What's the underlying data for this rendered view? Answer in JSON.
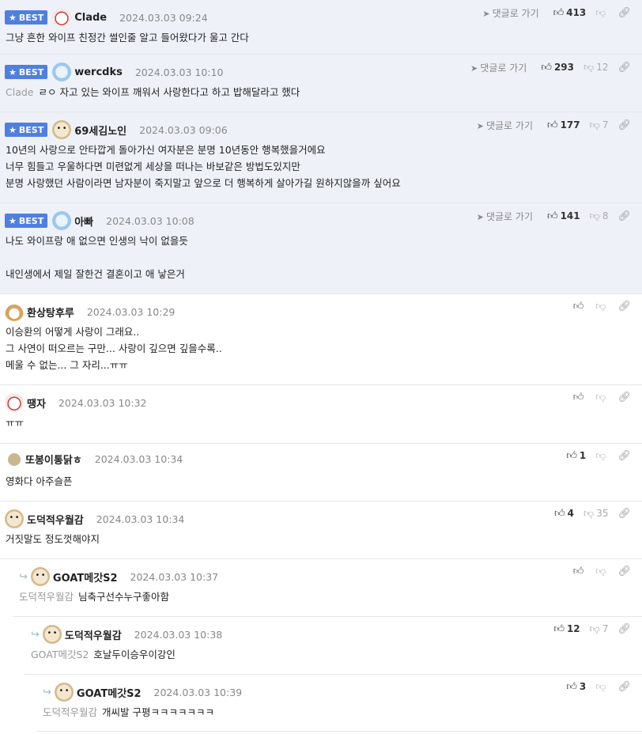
{
  "labels": {
    "best": "BEST",
    "goto": "댓글로 가기"
  },
  "comments": [
    {
      "author": "Clade",
      "date": "2024.03.03 09:24",
      "up": "413",
      "down": "",
      "lines": [
        "그냥 흔한 와이프 친정간 썰인줄 알고 들어왔다가 울고 간다"
      ]
    },
    {
      "author": "wercdks",
      "date": "2024.03.03 10:10",
      "up": "293",
      "down": "12",
      "ref": "Clade",
      "lines": [
        "ㄹㅇ 자고 있는 와이프 깨워서 사랑한다고 하고 밥해달라고 했다"
      ]
    },
    {
      "author": "69세김노인",
      "date": "2024.03.03 09:06",
      "up": "177",
      "down": "7",
      "lines": [
        "10년의 사랑으로 안타깝게 돌아가신 여자분은 분명 10년동안 행복했을거에요",
        "너무 힘들고 우울하다면 미련없게 세상을 떠나는 바보같은 방법도있지만",
        "분명 사랑했던 사람이라면 남자분이 죽지말고 앞으로 더 행복하게 살아가길 원하지않을까 싶어요"
      ]
    },
    {
      "author": "아빠",
      "date": "2024.03.03 10:08",
      "up": "141",
      "down": "8",
      "lines": [
        "나도 와이프랑 애 없으면 인생의 낙이 없을듯",
        "",
        "내인생에서 제일 잘한건 결혼이고 애 낳은거"
      ]
    },
    {
      "author": "환상탕후루",
      "date": "2024.03.03 10:29",
      "up": "",
      "down": "",
      "lines": [
        "이승환의 어떻게 사랑이 그래요..",
        "그 사연이 떠오르는 구만... 사랑이 깊으면 깊을수록..",
        "메울 수 없는... 그 자리...ㅠㅠ"
      ]
    },
    {
      "author": "땡자",
      "date": "2024.03.03 10:32",
      "up": "",
      "down": "",
      "lines": [
        "ㅠㅠ"
      ]
    },
    {
      "author": "또봉이통닭ㅎ",
      "date": "2024.03.03 10:34",
      "up": "1",
      "down": "",
      "lines": [
        "영화다 아주슬픈"
      ]
    },
    {
      "author": "도덕적우월감",
      "date": "2024.03.03 10:34",
      "up": "4",
      "down": "35",
      "lines": [
        "거짓말도 정도껏해야지"
      ]
    },
    {
      "author": "GOAT메갓S2",
      "date": "2024.03.03 10:37",
      "up": "",
      "down": "",
      "ref": "도덕적우월감",
      "lines": [
        "님축구선수누구좋아함"
      ]
    },
    {
      "author": "도덕적우월감",
      "date": "2024.03.03 10:38",
      "up": "12",
      "down": "7",
      "ref": "GOAT메갓S2",
      "lines": [
        "호날두이승우이강인"
      ]
    },
    {
      "author": "GOAT메갓S2",
      "date": "2024.03.03 10:39",
      "up": "3",
      "down": "",
      "ref": "도덕적우월감",
      "lines": [
        "개씨발 구평ㅋㅋㅋㅋㅋㅋㅋ"
      ]
    }
  ]
}
